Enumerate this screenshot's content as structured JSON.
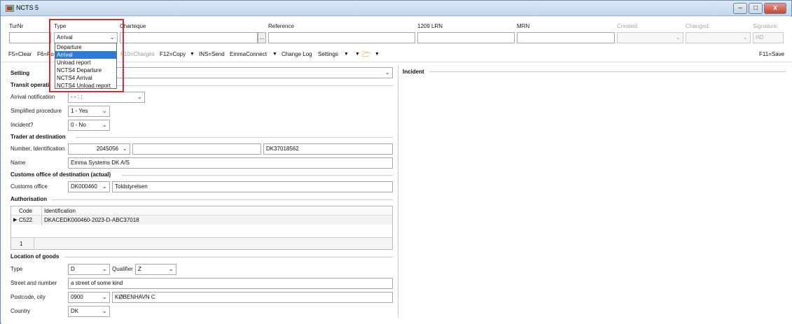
{
  "window": {
    "title": "NCTS 5",
    "minimize": "–",
    "maximize": "□",
    "close": "x"
  },
  "header": {
    "turnr_label": "TurNr",
    "turnr_value": "",
    "type_label": "Type",
    "type_value": "Arrival",
    "charteque_label": "Charteque",
    "charteque_value": "",
    "charteque_button": "...",
    "reference_label": "Reference",
    "reference_value": "",
    "lrn_label": "1209 LRN",
    "lrn_value": "",
    "mrn_label": "MRN",
    "mrn_value": "",
    "created_label": "Created:",
    "changed_label": "Changed:",
    "signature_label": "Signature:",
    "signature_value": "HD"
  },
  "type_dropdown": {
    "options": [
      "Departure",
      "Arrival",
      "Unload report",
      "NCTS4 Departure",
      "NCTS4 Arrival",
      "NCTS4 Unload report"
    ],
    "selected_index": 1
  },
  "toolbar": {
    "clear": "F5=Clear",
    "f6": "F6=Po",
    "charges": "F10=Charges",
    "copy": "F12=Copy",
    "send": "INS=Send",
    "emmaconnect": "EmmaConnect",
    "changelog": "Change Log",
    "settings": "Settings",
    "save": "F11=Save"
  },
  "form": {
    "setting_label": "Setting",
    "setting_value": "",
    "transit_section": "Transit operati",
    "arrival_notification_label": "Arrival notification",
    "arrival_notification_value": "- -    : :",
    "simplified_label": "Simplified procedure",
    "simplified_value": "1 - Yes",
    "incident_label": "Incident?",
    "incident_value": "0 - No",
    "trader_section": "Trader at destination",
    "number_label": "Number, Identification",
    "number_value": "2045056",
    "ident_extra": "",
    "ident_value": "DK37018562",
    "name_label": "Name",
    "name_value": "Emma Systems DK A/S",
    "customs_section": "Customs office of destination (actual)",
    "customs_label": "Customs office",
    "customs_code": "DK000460",
    "customs_name": "Toldstyrelsen",
    "auth_section": "Authorisation",
    "auth_col_code": "Code",
    "auth_col_ident": "Identification",
    "auth_row_code": "C522",
    "auth_row_ident": "DKACEDK000460-2023-D-ABC37018",
    "auth_count": "1",
    "location_section": "Location of goods",
    "loc_type_label": "Type",
    "loc_type_value": "D",
    "qualifier_label": "Qualifier",
    "qualifier_value": "Z",
    "street_label": "Street and number",
    "street_value": "a street of some kind",
    "postcode_label": "Postcode, city",
    "postcode_value": "0900",
    "city_value": "KØBENHAVN C",
    "country_label": "Country",
    "country_value": "DK"
  },
  "incident_panel": {
    "title": "Incident"
  },
  "colors": {
    "highlight": "#d9282f",
    "selection": "#3079d6",
    "titlebar": "#c3d6ec"
  }
}
